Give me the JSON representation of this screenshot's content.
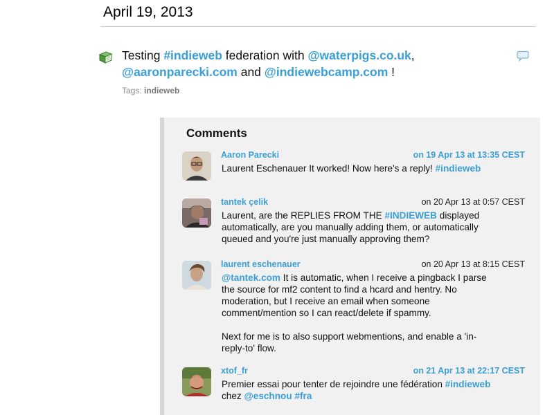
{
  "date": "April 19, 2013",
  "post": {
    "parts": [
      "Testing ",
      "#indieweb",
      " federation with ",
      "@waterpigs.co.uk",
      ",",
      "@aaronparecki.com",
      " and ",
      "@indiewebcamp.com",
      " !"
    ],
    "tags_label": "Tags:",
    "tag": "indieweb"
  },
  "comments": {
    "title": "Comments",
    "items": [
      {
        "author": "Aaron Parecki",
        "time": "on 19 Apr 13 at 13:35 CEST",
        "body": [
          "Laurent Eschenauer It worked! Now here's a reply! ",
          "#indieweb"
        ]
      },
      {
        "author": "tantek çelik",
        "time": "on 20 Apr 13 at 0:57 CEST",
        "body": [
          "Laurent, are the REPLIES FROM THE ",
          "#INDIEWEB",
          " displayed automatically, are you manually adding them, or automatically queued and you're just manually approving them?"
        ]
      },
      {
        "author": "laurent eschenauer",
        "time": "on 20 Apr 13 at 8:15 CEST",
        "body": [
          "@tantek.com",
          " It is automatic, when I receive a pingback I parse the source for mf2 content to find a hcard and hentry. No moderation, but I receive an email when someone comment/mention so I can react/delete if spammy."
        ],
        "body2": "Next for me is to also support webmentions, and enable a 'in-reply-to' flow."
      },
      {
        "author": "xtof_fr",
        "time": "on 21 Apr 13 at 22:17 CEST",
        "body": [
          "Premier essai pour tenter de rejoindre une fédération ",
          "#indieweb",
          "chez ",
          "@eschnou",
          " ",
          "#fra"
        ]
      }
    ]
  },
  "colors": {
    "link": "#3a9fd6",
    "comments_bg": "#f1f1f1",
    "comments_border": "#d6d6d6"
  },
  "icons": {
    "post": "book-icon",
    "reply": "speech-bubble-icon"
  }
}
